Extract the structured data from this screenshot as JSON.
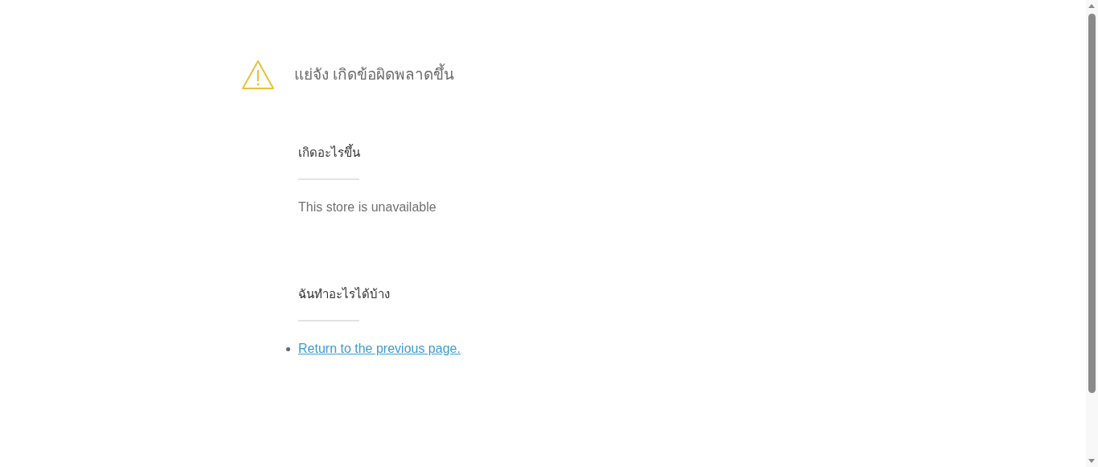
{
  "title": "แย่จัง เกิดข้อผิดพลาดขึ้น",
  "sections": [
    {
      "heading": "เกิดอะไรขึ้น",
      "kind": "text",
      "text": "This store is unavailable"
    },
    {
      "heading": "ฉันทำอะไรได้บ้าง",
      "kind": "links",
      "links": [
        "Return to the previous page."
      ]
    }
  ]
}
